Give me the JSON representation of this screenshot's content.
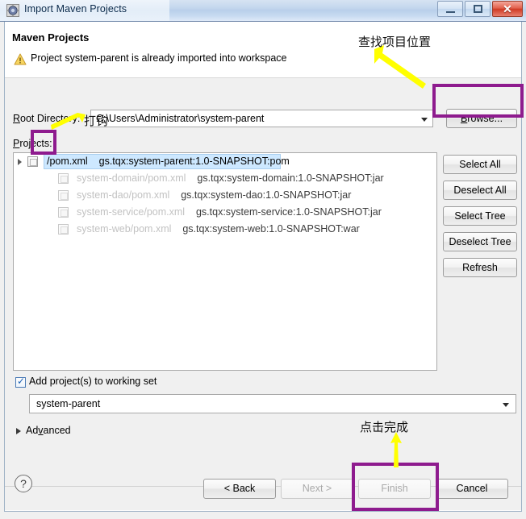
{
  "window": {
    "title": "Import Maven Projects",
    "icon": "maven-import-icon",
    "controls": {
      "minimize": "minimize-button",
      "maximize": "maximize-button",
      "close_glyph": "✕"
    }
  },
  "header": {
    "title": "Maven Projects",
    "warning_icon": "warning-icon",
    "warning_text": "Project system-parent is already imported into workspace"
  },
  "form": {
    "root_directory_label": "Root Directory:",
    "root_directory_value": "C:\\Users\\Administrator\\system-parent",
    "browse_label": "Browse...",
    "projects_label": "Projects:"
  },
  "tree": {
    "rows": [
      {
        "path": "/pom.xml",
        "gav": "gs.tqx:system-parent:1.0-SNAPSHOT:pom",
        "checked": false,
        "selected": true,
        "dimmed": false,
        "expander": true
      },
      {
        "path": "system-domain/pom.xml",
        "gav": "gs.tqx:system-domain:1.0-SNAPSHOT:jar",
        "checked": false,
        "selected": false,
        "dimmed": true,
        "expander": false
      },
      {
        "path": "system-dao/pom.xml",
        "gav": "gs.tqx:system-dao:1.0-SNAPSHOT:jar",
        "checked": false,
        "selected": false,
        "dimmed": true,
        "expander": false
      },
      {
        "path": "system-service/pom.xml",
        "gav": "gs.tqx:system-service:1.0-SNAPSHOT:jar",
        "checked": false,
        "selected": false,
        "dimmed": true,
        "expander": false
      },
      {
        "path": "system-web/pom.xml",
        "gav": "gs.tqx:system-web:1.0-SNAPSHOT:war",
        "checked": false,
        "selected": false,
        "dimmed": true,
        "expander": false
      }
    ]
  },
  "side_buttons": [
    {
      "label": "Select All"
    },
    {
      "label": "Deselect All"
    },
    {
      "label": "Select Tree"
    },
    {
      "label": "Deselect Tree"
    },
    {
      "label": "Refresh"
    }
  ],
  "working_set": {
    "checkbox_checked": true,
    "checkbox_glyph": "✓",
    "label": "Add project(s) to working set",
    "selected_value": "system-parent"
  },
  "advanced": {
    "label": "Advanced",
    "expanded": false
  },
  "footer": {
    "help_glyph": "?",
    "buttons": [
      {
        "label": "< Back",
        "disabled": false
      },
      {
        "label": "Next >",
        "disabled": true
      },
      {
        "label": "Finish",
        "disabled": true
      },
      {
        "label": "Cancel",
        "disabled": false
      }
    ]
  },
  "annotations": {
    "highlight_color": "#8e1b8e",
    "arrow_color": "#ffff00",
    "notes": [
      {
        "text": "查找项目位置",
        "target": "browse-button"
      },
      {
        "text": "打钩",
        "target": "parent-project-checkbox"
      },
      {
        "text": "点击完成",
        "target": "finish-button"
      }
    ]
  }
}
